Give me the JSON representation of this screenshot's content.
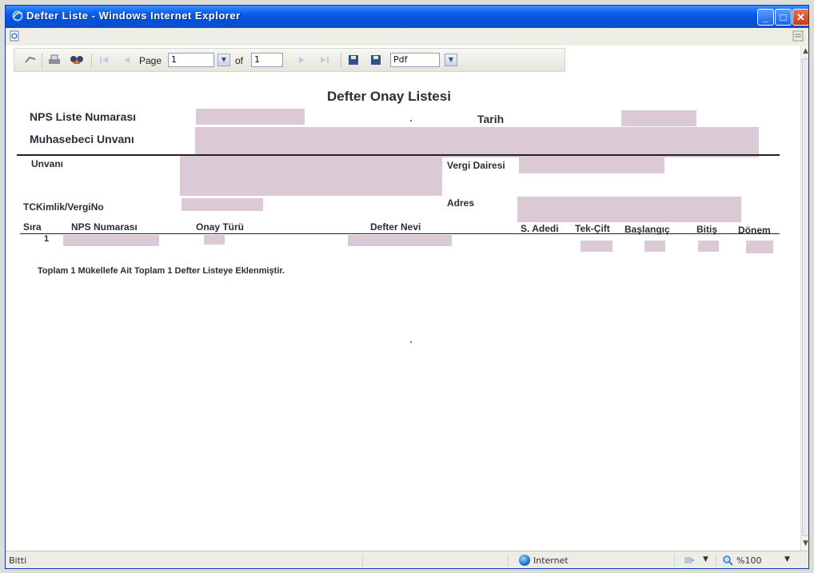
{
  "window": {
    "title": "Defter Liste - Windows Internet Explorer",
    "minimize_glyph": "_",
    "maximize_glyph": "□",
    "close_glyph": "✕"
  },
  "toolbar": {
    "page_label": "Page",
    "page_value": "1",
    "of_label": "of",
    "total_pages": "1",
    "export_format": "Pdf"
  },
  "report": {
    "title": "Defter Onay Listesi",
    "nps_liste_label": "NPS Liste Numarası",
    "tarih_label": "Tarih",
    "muhasebeci_label": "Muhasebeci Unvanı",
    "unvan_label": "Unvanı",
    "vergi_dairesi_label": "Vergi Dairesi",
    "tckimlik_label": "TCKimlik/VergiNo",
    "adres_label": "Adres",
    "columns": [
      "Sıra",
      "NPS Numarası",
      "Onay Türü",
      "Defter Nevi",
      "S. Adedi",
      "Tek-Çift",
      "Başlangıç",
      "Bitiş",
      "Dönem"
    ],
    "rows": [
      {
        "sira": "1"
      }
    ],
    "summary": "Toplam 1 Mükellefe Ait Toplam 1 Defter Listeye Eklenmiştir."
  },
  "statusbar": {
    "status": "Bitti",
    "zone": "Internet",
    "zoom": "%100"
  },
  "colors": {
    "titlebar": "#0a5ee8",
    "redaction": "#dbc9d6",
    "label_text": "#2c2c3a"
  },
  "icons": [
    "ie-icon",
    "refresh-icon",
    "print-icon",
    "find-icon",
    "first-page-icon",
    "previous-page-icon",
    "next-page-icon",
    "last-page-icon",
    "save-icon",
    "export-icon",
    "globe-icon",
    "zoom-icon"
  ]
}
